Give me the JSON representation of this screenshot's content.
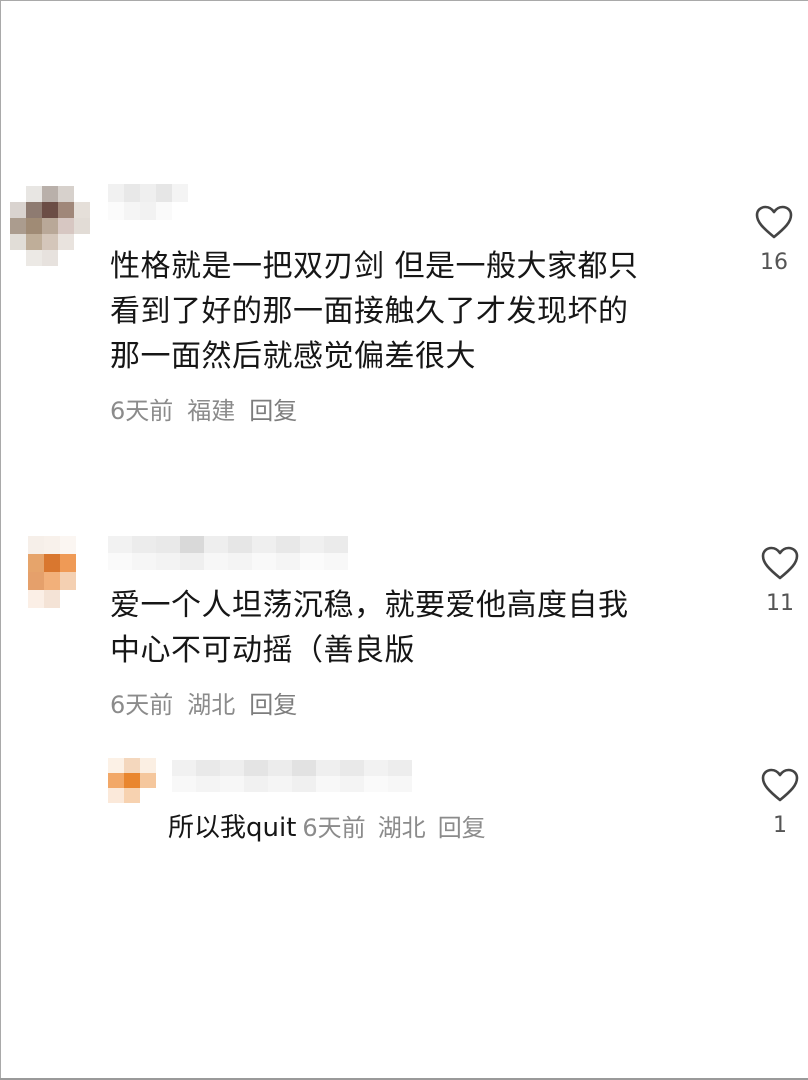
{
  "comments": [
    {
      "text_lines": [
        "性格就是一把双刃剑 但是一般大家都只",
        "看到了好的那一面接触久了才发现坏的",
        "那一面然后就感觉偏差很大"
      ],
      "time": "6天前",
      "location": "福建",
      "reply_label": "回复",
      "likes": "16",
      "icon": "heart-outline-icon"
    },
    {
      "text_lines": [
        "爱一个人坦荡沉稳，就要爱他高度自我",
        "中心不可动摇（善良版"
      ],
      "time": "6天前",
      "location": "湖北",
      "reply_label": "回复",
      "likes": "11",
      "icon": "heart-outline-icon"
    }
  ],
  "reply": {
    "text": "所以我quit",
    "time": "6天前",
    "location": "湖北",
    "reply_label": "回复",
    "likes": "1",
    "icon": "heart-outline-icon"
  },
  "colors": {
    "text": "#161616",
    "meta": "#8b8b8b",
    "icon": "#444444",
    "background": "#ffffff"
  }
}
